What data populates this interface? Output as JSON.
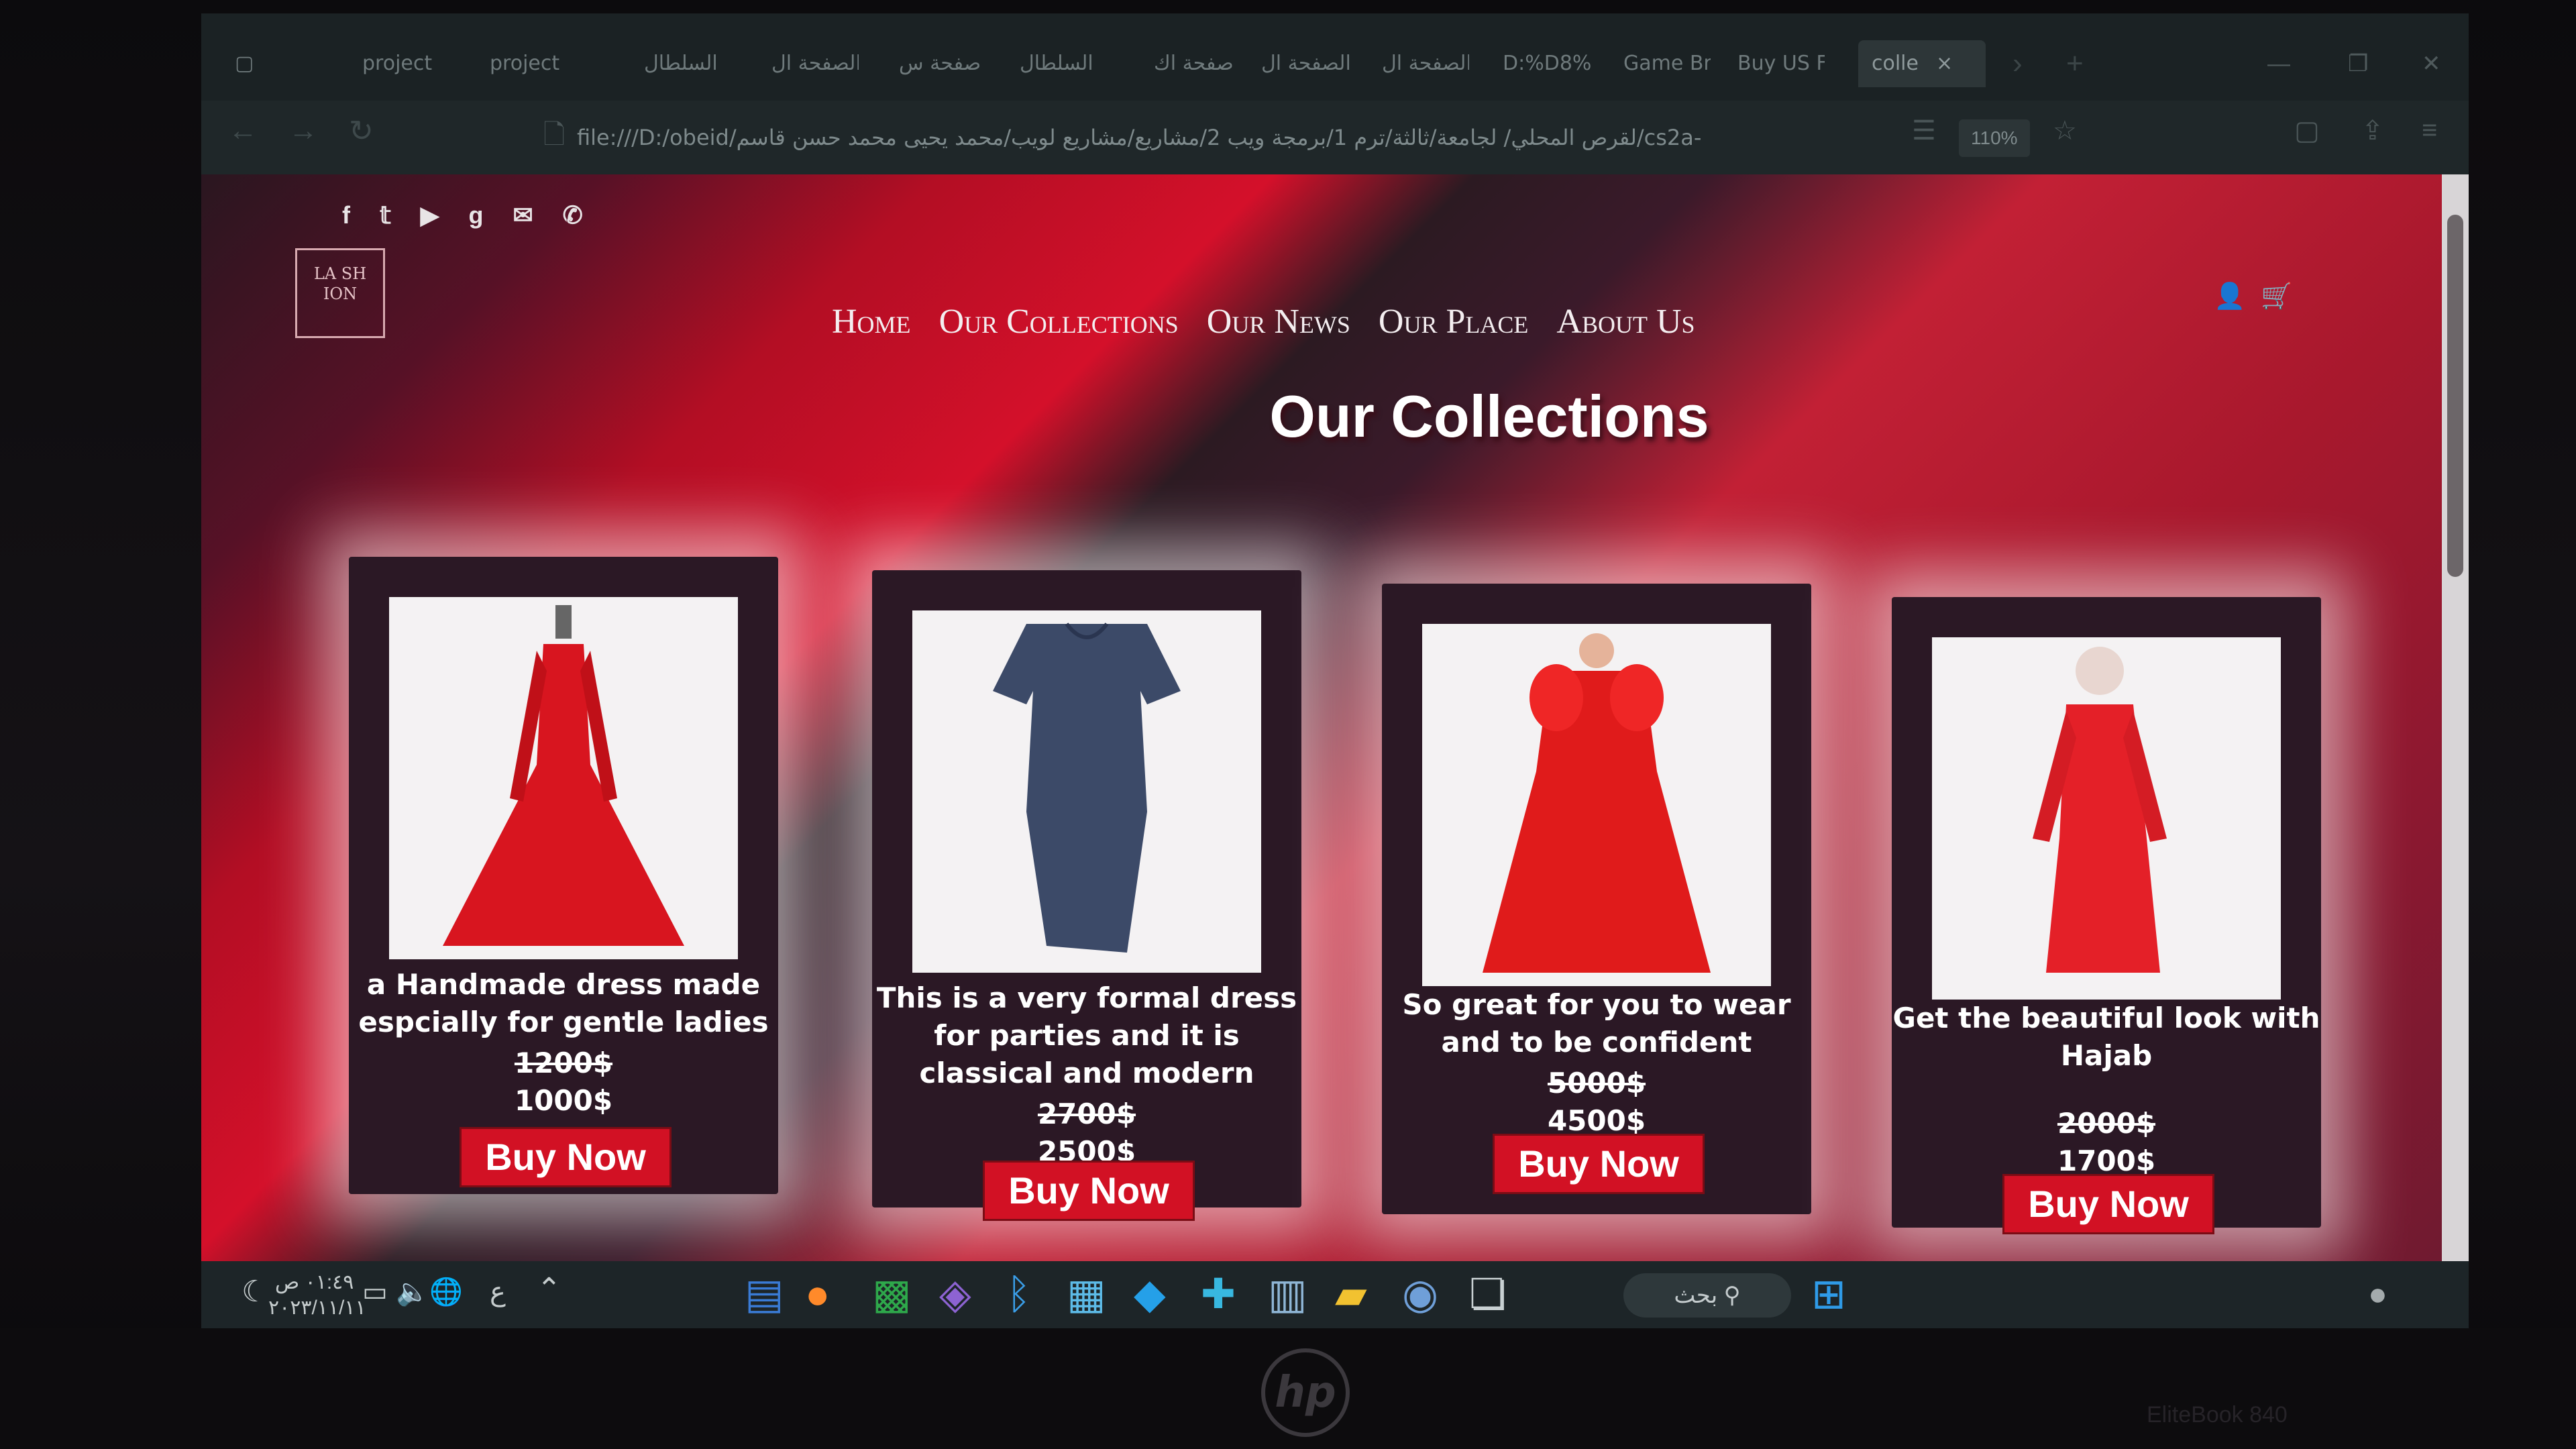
{
  "browser": {
    "tabs": [
      "project",
      "project",
      "السلطال",
      "الصفحة ال",
      "صفحة س",
      "السلطال",
      "صفحة اك",
      "الصفحة ال",
      "الصفحة ال",
      "D:%D8%",
      "Game Bro",
      "Buy US Fa",
      "colle"
    ],
    "active_tab_close": "×",
    "url": "file:///D:/obeid/لقرص المحلي/ لجامعة/ثالثة/ترم 1/برمجة ويب 2/مشاريع/مشاريع لويب/محمد يحيى محمد حسن قاسم/cs2a-",
    "zoom": "110%"
  },
  "site": {
    "logo_text": "LA SH ION",
    "nav": [
      "Home",
      "Our Collections",
      "Our News",
      "Our Place",
      "About Us"
    ],
    "page_title": "Our Collections",
    "social_icons": [
      "facebook-icon",
      "twitter-icon",
      "youtube-icon",
      "google-plus-icon",
      "mail-icon",
      "phone-icon"
    ]
  },
  "products": [
    {
      "description": "a Handmade dress made espcially for gentle ladies",
      "old_price": "1200$",
      "price": "1000$",
      "button": "Buy Now"
    },
    {
      "description": "This is a very formal dress for parties and it is classical and modern",
      "old_price": "2700$",
      "price": "2500$",
      "button": "Buy Now"
    },
    {
      "description": "So great for you to wear and to be confident",
      "old_price": "5000$",
      "price": "4500$",
      "button": "Buy Now"
    },
    {
      "description": "Get the beautiful look with Hajab",
      "old_price": "2000$",
      "price": "1700$",
      "button": "Buy Now"
    }
  ],
  "taskbar": {
    "time": "٠١:٤٩ ص",
    "date": "٢٠٢٣/١١/١١",
    "lang": "ع",
    "search": "بحث"
  },
  "device": {
    "brand": "hp",
    "model": "EliteBook 840"
  }
}
